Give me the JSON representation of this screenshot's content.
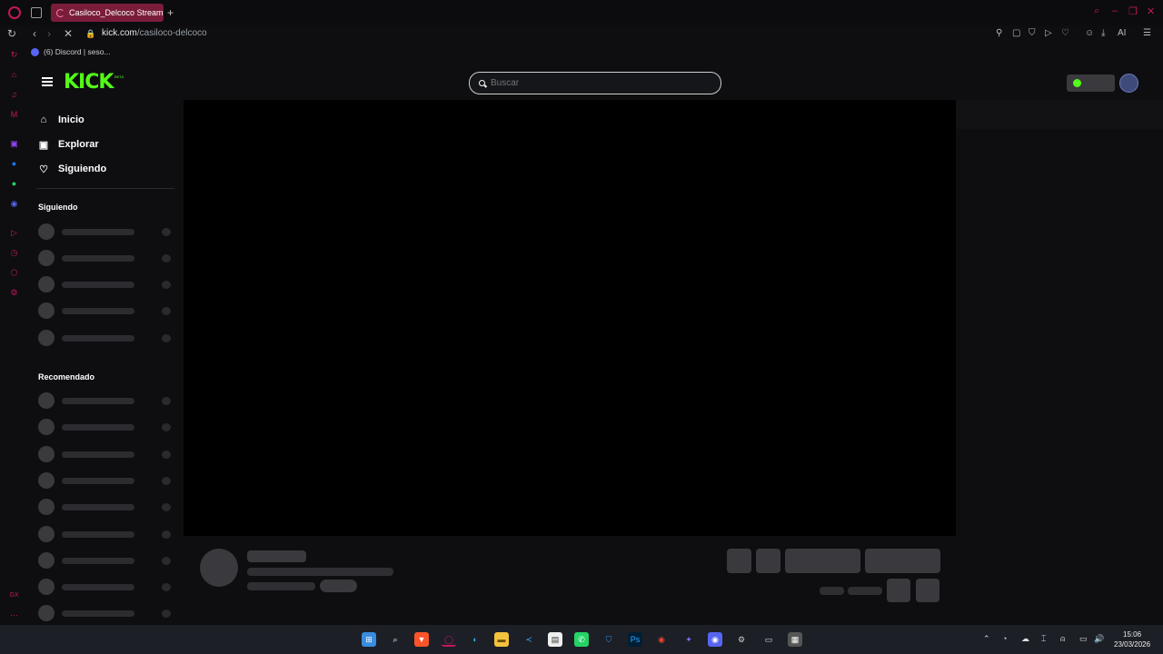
{
  "browser": {
    "tab_title": "Casiloco_Delcoco Stream",
    "url_host": "kick.com",
    "url_path": "/casiloco-delcoco",
    "bookmark_label": "(6) Discord | seso..."
  },
  "header": {
    "logo_text": "KICK",
    "beta_text": "BETA",
    "search_placeholder": "Buscar"
  },
  "nav": {
    "items": [
      {
        "label": "Inicio",
        "icon": "home-icon"
      },
      {
        "label": "Explorar",
        "icon": "compass-icon"
      },
      {
        "label": "Siguiendo",
        "icon": "heart-icon"
      }
    ]
  },
  "sections": {
    "following_title": "Siguiendo",
    "recommended_title": "Recomendado"
  },
  "taskbar": {
    "time": "15:06",
    "date": "23/03/2026",
    "ai_label": "AI",
    "ps_label": "Ps"
  },
  "colors": {
    "accent": "#53fc18",
    "opera_red": "#c2185b",
    "tab_active": "#7a1d3a"
  }
}
